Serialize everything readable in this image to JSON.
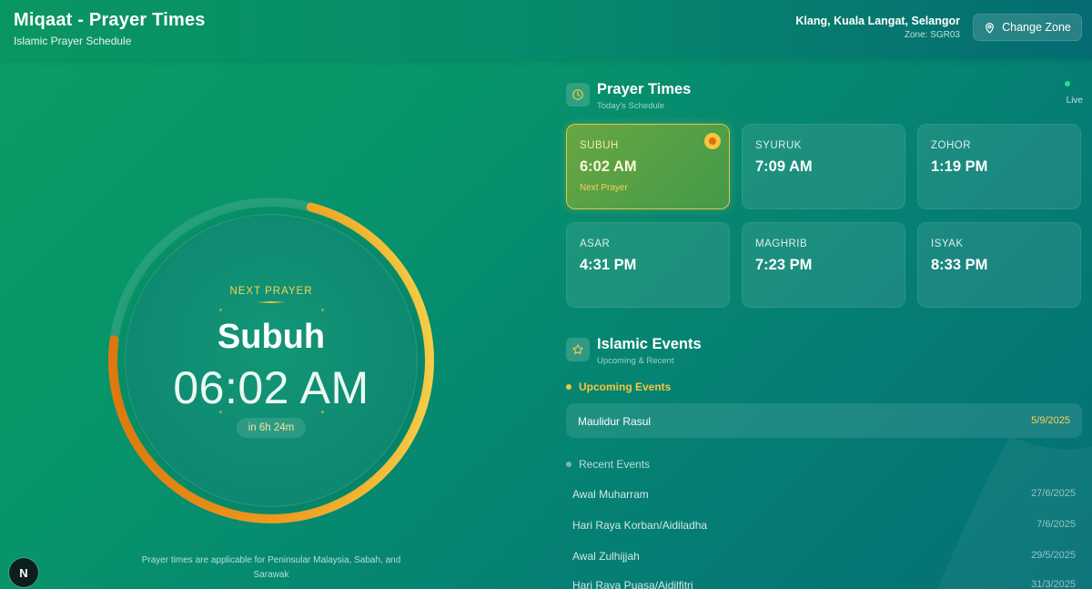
{
  "header": {
    "title": "Miqaat - Prayer Times",
    "subtitle": "Islamic Prayer Schedule",
    "location": "Klang, Kuala Langat, Selangor",
    "zone": "Zone: SGR03",
    "change_zone_label": "Change Zone"
  },
  "next_prayer": {
    "label": "NEXT PRAYER",
    "name": "Subuh",
    "time": "06:02 AM",
    "countdown": "in 6h 24m",
    "progress_fraction": 0.73
  },
  "footnote": "Prayer times are applicable for Peninsular Malaysia, Sabah, and Sarawak",
  "badge_letter": "N",
  "prayer_section": {
    "title": "Prayer Times",
    "subtitle": "Today's Schedule",
    "live_label": "Live",
    "next_marker": "Next Prayer",
    "prayers": [
      {
        "name": "SUBUH",
        "time": "6:02 AM"
      },
      {
        "name": "SYURUK",
        "time": "7:09 AM"
      },
      {
        "name": "ZOHOR",
        "time": "1:19 PM"
      },
      {
        "name": "ASAR",
        "time": "4:31 PM"
      },
      {
        "name": "MAGHRIB",
        "time": "7:23 PM"
      },
      {
        "name": "ISYAK",
        "time": "8:33 PM"
      }
    ]
  },
  "events_section": {
    "title": "Islamic Events",
    "subtitle": "Upcoming & Recent",
    "upcoming_label": "Upcoming Events",
    "recent_label": "Recent Events",
    "upcoming": [
      {
        "name": "Maulidur Rasul",
        "date": "5/9/2025"
      }
    ],
    "recent": [
      {
        "name": "Awal Muharram",
        "date": "27/6/2025"
      },
      {
        "name": "Hari Raya Korban/Aidiladha",
        "date": "7/6/2025"
      },
      {
        "name": "Awal Zulhijjah",
        "date": "29/5/2025"
      },
      {
        "name": "Hari Raya Puasa/Aidilfitri",
        "date": "31/3/2025"
      }
    ]
  },
  "colors": {
    "accent_gold": "#f5c542",
    "accent_orange": "#e0700a",
    "live_green": "#2ee07a"
  },
  "icons": {
    "location": "map-pin-icon",
    "prayer": "clock-icon",
    "events": "star-icon"
  }
}
